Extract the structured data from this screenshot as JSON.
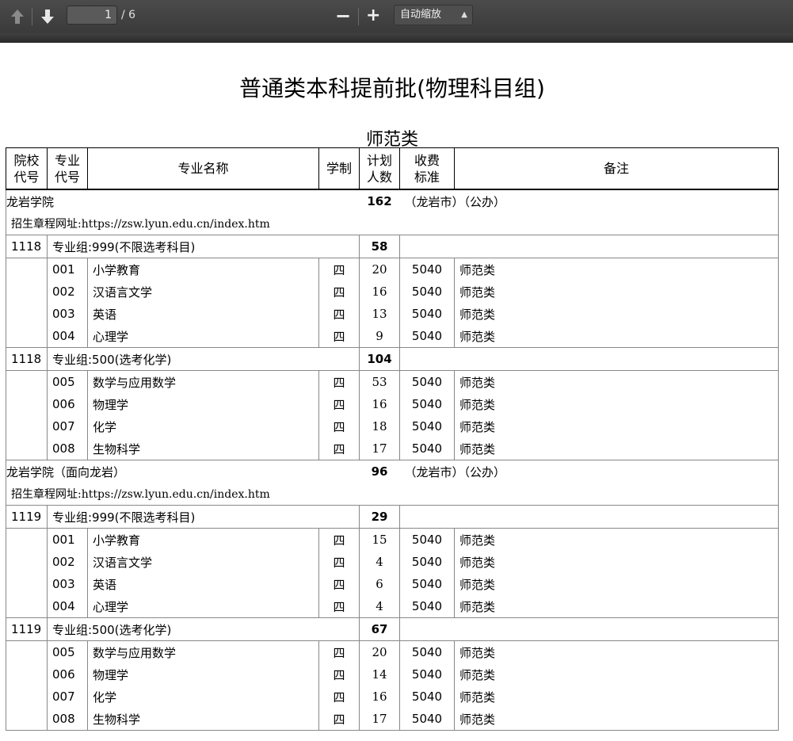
{
  "toolbar": {
    "page_current": "1",
    "page_total": "/ 6",
    "zoom_out_label": "−",
    "zoom_in_label": "+",
    "zoom_selected": "自动缩放"
  },
  "document": {
    "title": "普通类本科提前批(物理科目组)",
    "section": "师范类",
    "headers": [
      "院校\n代号",
      "专业\n代号",
      "专业名称",
      "学制",
      "计划\n人数",
      "收费\n标准",
      "备注"
    ],
    "schools": [
      {
        "name": "龙岩学院",
        "plan": "162",
        "note": "（龙岩市）（公办）",
        "url": "招生章程网址:https://zsw.lyun.edu.cn/index.htm",
        "groups": [
          {
            "code": "1118",
            "name": "专业组:999(不限选考科目)",
            "plan": "58",
            "majors": [
              {
                "code": "001",
                "name": "小学教育",
                "years": "四",
                "plan": "20",
                "fee": "5040",
                "note": "师范类"
              },
              {
                "code": "002",
                "name": "汉语言文学",
                "years": "四",
                "plan": "16",
                "fee": "5040",
                "note": "师范类"
              },
              {
                "code": "003",
                "name": "英语",
                "years": "四",
                "plan": "13",
                "fee": "5040",
                "note": "师范类"
              },
              {
                "code": "004",
                "name": "心理学",
                "years": "四",
                "plan": "9",
                "fee": "5040",
                "note": "师范类"
              }
            ]
          },
          {
            "code": "1118",
            "name": "专业组:500(选考化学)",
            "plan": "104",
            "majors": [
              {
                "code": "005",
                "name": "数学与应用数学",
                "years": "四",
                "plan": "53",
                "fee": "5040",
                "note": "师范类"
              },
              {
                "code": "006",
                "name": "物理学",
                "years": "四",
                "plan": "16",
                "fee": "5040",
                "note": "师范类"
              },
              {
                "code": "007",
                "name": "化学",
                "years": "四",
                "plan": "18",
                "fee": "5040",
                "note": "师范类"
              },
              {
                "code": "008",
                "name": "生物科学",
                "years": "四",
                "plan": "17",
                "fee": "5040",
                "note": "师范类"
              }
            ]
          }
        ]
      },
      {
        "name": "龙岩学院（面向龙岩）",
        "plan": "96",
        "note": "（龙岩市）（公办）",
        "url": "招生章程网址:https://zsw.lyun.edu.cn/index.htm",
        "groups": [
          {
            "code": "1119",
            "name": "专业组:999(不限选考科目)",
            "plan": "29",
            "majors": [
              {
                "code": "001",
                "name": "小学教育",
                "years": "四",
                "plan": "15",
                "fee": "5040",
                "note": "师范类"
              },
              {
                "code": "002",
                "name": "汉语言文学",
                "years": "四",
                "plan": "4",
                "fee": "5040",
                "note": "师范类"
              },
              {
                "code": "003",
                "name": "英语",
                "years": "四",
                "plan": "6",
                "fee": "5040",
                "note": "师范类"
              },
              {
                "code": "004",
                "name": "心理学",
                "years": "四",
                "plan": "4",
                "fee": "5040",
                "note": "师范类"
              }
            ]
          },
          {
            "code": "1119",
            "name": "专业组:500(选考化学)",
            "plan": "67",
            "majors": [
              {
                "code": "005",
                "name": "数学与应用数学",
                "years": "四",
                "plan": "20",
                "fee": "5040",
                "note": "师范类"
              },
              {
                "code": "006",
                "name": "物理学",
                "years": "四",
                "plan": "14",
                "fee": "5040",
                "note": "师范类"
              },
              {
                "code": "007",
                "name": "化学",
                "years": "四",
                "plan": "16",
                "fee": "5040",
                "note": "师范类"
              },
              {
                "code": "008",
                "name": "生物科学",
                "years": "四",
                "plan": "17",
                "fee": "5040",
                "note": "师范类"
              }
            ]
          }
        ]
      }
    ]
  }
}
